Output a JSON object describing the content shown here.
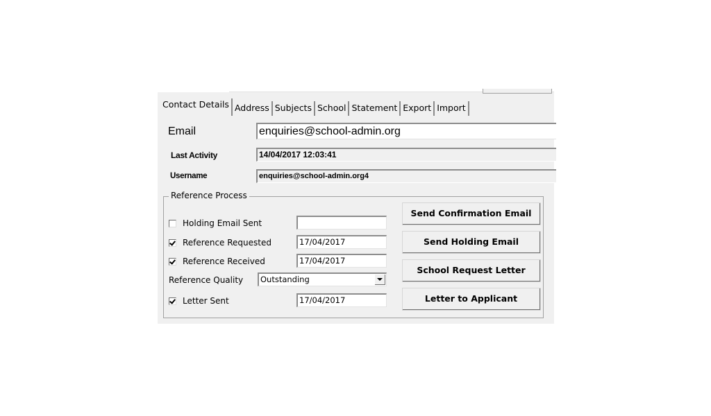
{
  "tabs": [
    {
      "label": "Contact Details",
      "active": true
    },
    {
      "label": "Address",
      "active": false
    },
    {
      "label": "Subjects",
      "active": false
    },
    {
      "label": "School",
      "active": false
    },
    {
      "label": "Statement",
      "active": false
    },
    {
      "label": "Export",
      "active": false
    },
    {
      "label": "Import",
      "active": false
    }
  ],
  "contact": {
    "email_label": "Email",
    "email_value": "enquiries@school-admin.org",
    "last_activity_label": "Last Activity",
    "last_activity_value": "14/04/2017 12:03:41",
    "username_label": "Username",
    "username_value": "enquiries@school-admin.org4"
  },
  "reference_process": {
    "title": "Reference Process",
    "holding_email_sent": {
      "label": "Holding Email Sent",
      "checked": false,
      "date": ""
    },
    "reference_requested": {
      "label": "Reference Requested",
      "checked": true,
      "date": "17/04/2017"
    },
    "reference_received": {
      "label": "Reference Received",
      "checked": true,
      "date": "17/04/2017"
    },
    "reference_quality": {
      "label": "Reference Quality",
      "selected": "Outstanding"
    },
    "letter_sent": {
      "label": "Letter Sent",
      "checked": true,
      "date": "17/04/2017"
    }
  },
  "buttons": {
    "send_confirmation_email": "Send Confirmation Email",
    "send_holding_email": "Send Holding Email",
    "school_request_letter": "School Request Letter",
    "letter_to_applicant": "Letter to Applicant"
  }
}
